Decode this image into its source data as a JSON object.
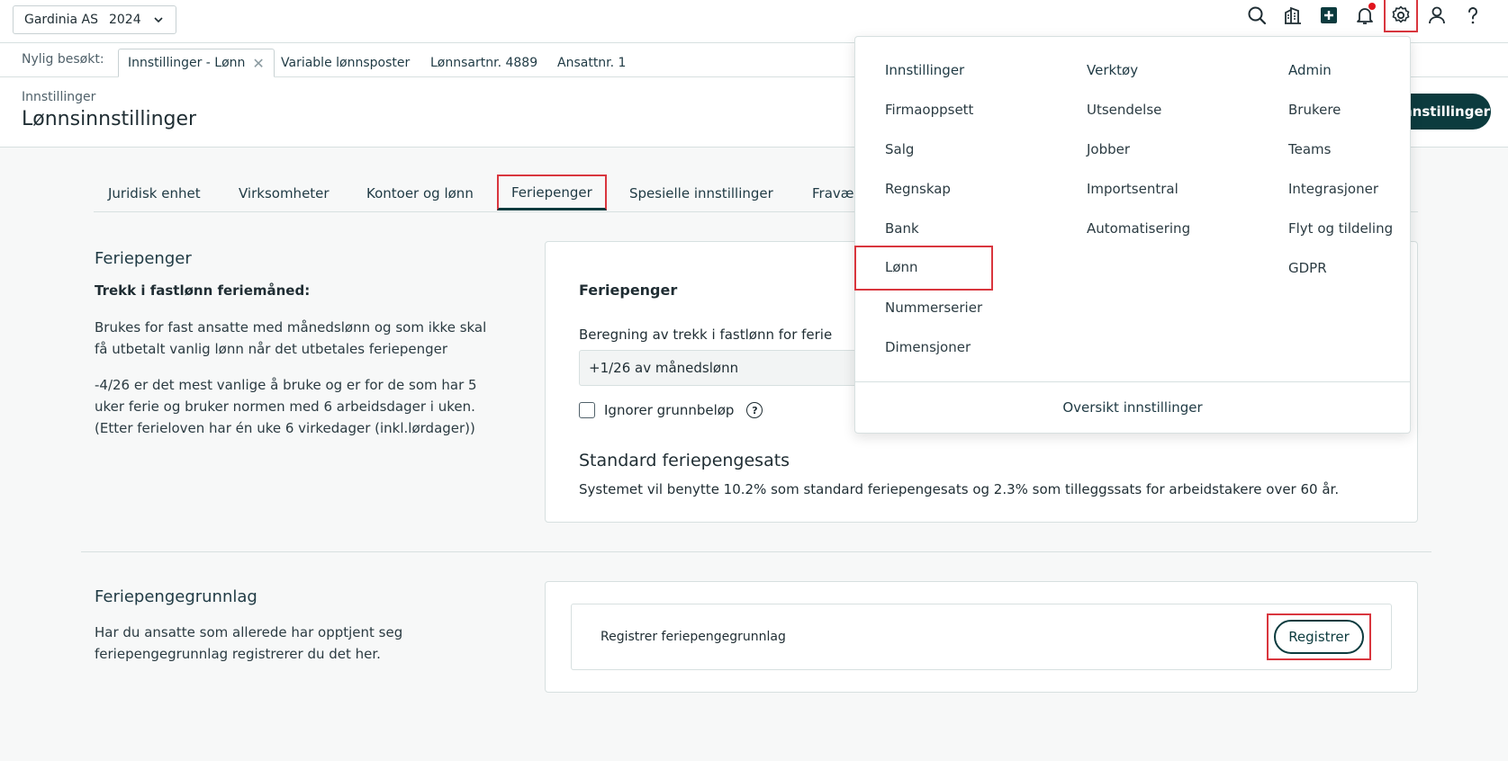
{
  "topbar": {
    "company": "Gardinia AS",
    "year": "2024",
    "icons": [
      "search-icon",
      "building-icon",
      "plus-square-icon",
      "bell-icon",
      "gear-icon",
      "user-icon",
      "help-icon"
    ]
  },
  "recent": {
    "label": "Nylig besøkt:",
    "tabs": [
      {
        "label": "Innstillinger - Lønn",
        "active": true
      },
      {
        "label": "Variable lønnsposter"
      },
      {
        "label": "Lønnsartnr. 4889"
      },
      {
        "label": "Ansattnr. 1"
      }
    ]
  },
  "header": {
    "breadcrumb": "Innstillinger",
    "title": "Lønnsinnstillinger",
    "button": "nnstillinger"
  },
  "tabs": [
    {
      "label": "Juridisk enhet"
    },
    {
      "label": "Virksomheter"
    },
    {
      "label": "Kontoer og lønn"
    },
    {
      "label": "Feriepenger",
      "active": true
    },
    {
      "label": "Spesielle innstillinger"
    },
    {
      "label": "Fravær"
    }
  ],
  "feriepenger": {
    "title": "Feriepenger",
    "subtitle": "Trekk i fastlønn feriemåned:",
    "para1": "Brukes for fast ansatte med månedslønn og som ikke skal få utbetalt vanlig lønn når det utbetales feriepenger",
    "para2": "-4/26 er det mest vanlige å bruke og er for de som har 5 uker ferie og bruker normen med 6 arbeidsdager i uken. (Etter ferieloven har én uke 6 virkedager (inkl.lørdager))",
    "card": {
      "title": "Feriepenger",
      "field_label": "Beregning av trekk i fastlønn for ferie",
      "field_value": "+1/26 av månedslønn",
      "checkbox_label": "Ignorer grunnbeløp",
      "std_heading": "Standard feriepengesats",
      "std_text": "Systemet vil benytte 10.2% som standard feriepengesats og 2.3% som tilleggssats for arbeidstakere over 60 år."
    }
  },
  "grunnlag": {
    "title": "Feriepengegrunnlag",
    "para": "Har du ansatte som allerede har opptjent seg feriepengegrunnlag registrerer du det her.",
    "row_label": "Registrer feriepengegrunnlag",
    "button": "Registrer"
  },
  "menu": {
    "columns": [
      {
        "heading": "Innstillinger",
        "items": [
          "Firmaoppsett",
          "Salg",
          "Regnskap",
          "Bank",
          "Lønn",
          "Nummerserier",
          "Dimensjoner"
        ]
      },
      {
        "heading": "Verktøy",
        "items": [
          "Utsendelse",
          "Jobber",
          "Importsentral",
          "Automatisering"
        ]
      },
      {
        "heading": "Admin",
        "items": [
          "Brukere",
          "Teams",
          "Integrasjoner",
          "Flyt og tildeling",
          "GDPR"
        ]
      }
    ],
    "footer": "Oversikt innstillinger"
  },
  "colors": {
    "accent": "#0c3b3e",
    "highlight": "#d9363e",
    "notification": "#e0141d"
  }
}
